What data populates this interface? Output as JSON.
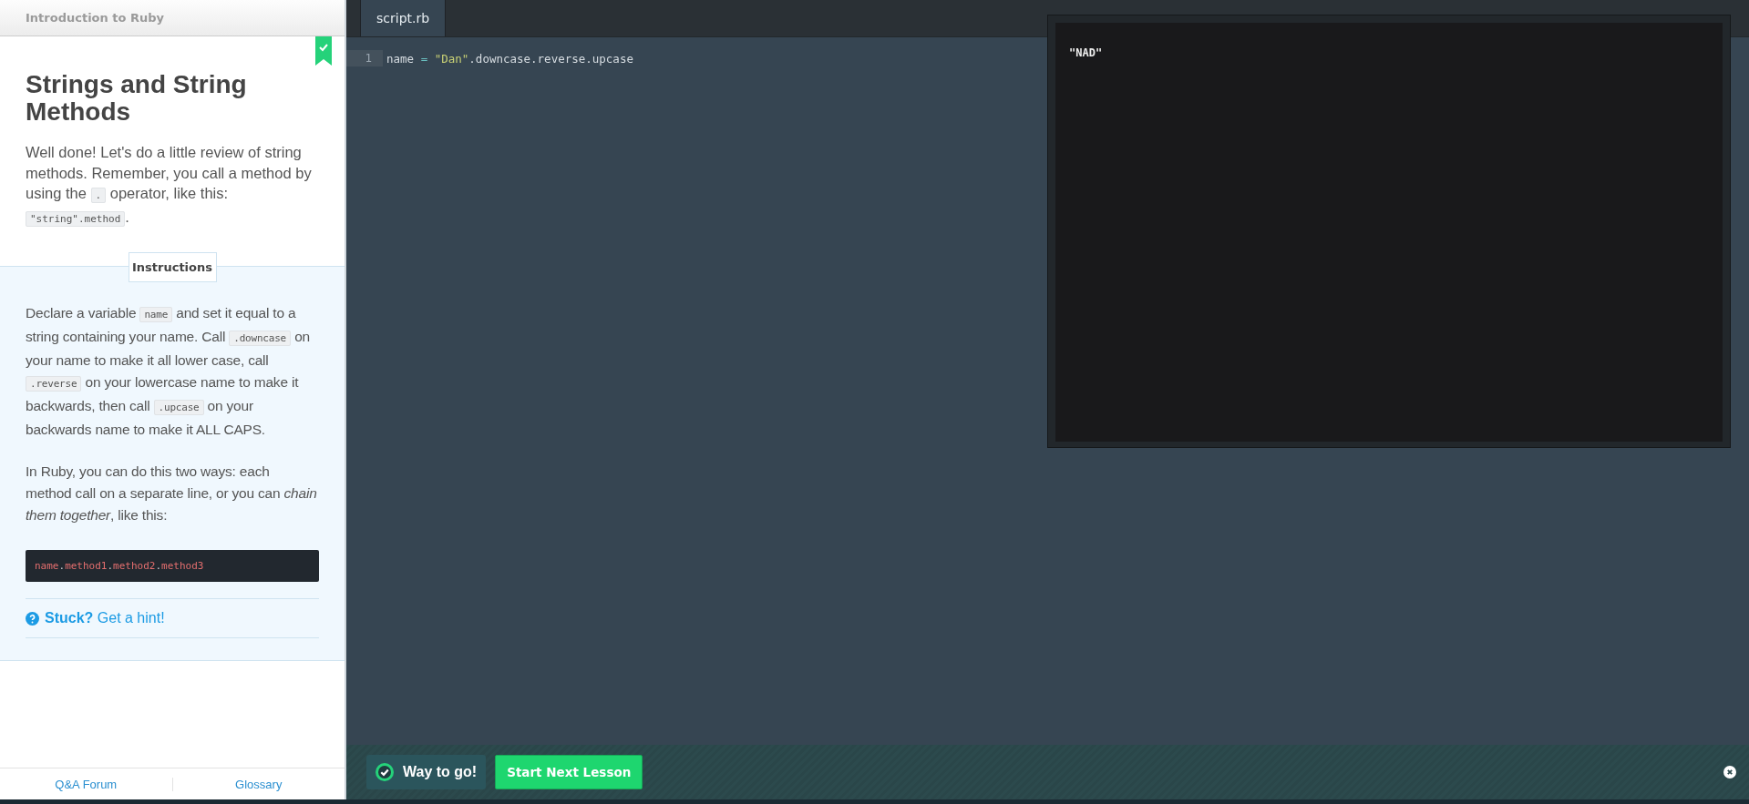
{
  "course": {
    "title": "Introduction to Ruby"
  },
  "lesson": {
    "completed": true,
    "title": "Strings and String Methods",
    "intro": [
      {
        "kind": "text",
        "text": "Well done! Let's do a little review of string methods. Remember, you call a method by using the "
      },
      {
        "kind": "code",
        "text": "."
      },
      {
        "kind": "text",
        "text": " operator, like this: "
      },
      {
        "kind": "code",
        "text": "\"string\".method"
      },
      {
        "kind": "text",
        "text": "."
      }
    ]
  },
  "instructions": {
    "tab": "Instructions",
    "paragraphs": [
      [
        {
          "kind": "text",
          "text": "Declare a variable "
        },
        {
          "kind": "code",
          "text": "name"
        },
        {
          "kind": "text",
          "text": " and set it equal to a string containing your name. Call "
        },
        {
          "kind": "code",
          "text": ".downcase"
        },
        {
          "kind": "text",
          "text": " on your name to make it all lower case, call "
        },
        {
          "kind": "code",
          "text": ".reverse"
        },
        {
          "kind": "text",
          "text": " on your lowercase name to make it backwards, then call "
        },
        {
          "kind": "code",
          "text": ".upcase"
        },
        {
          "kind": "text",
          "text": " on your backwards name to make it ALL CAPS."
        }
      ],
      [
        {
          "kind": "text",
          "text": "In Ruby, you can do this two ways: each method call on a separate line, or you can *chain them together*, like this:"
        }
      ]
    ],
    "code_sample": [
      {
        "kind": "ident",
        "text": "name"
      },
      {
        "kind": "dot",
        "text": "."
      },
      {
        "kind": "ident",
        "text": "method1"
      },
      {
        "kind": "dot",
        "text": "."
      },
      {
        "kind": "ident",
        "text": "method2"
      },
      {
        "kind": "dot",
        "text": "."
      },
      {
        "kind": "ident",
        "text": "method3"
      }
    ],
    "hint": {
      "label": "Stuck?",
      "link": "Get a hint!"
    }
  },
  "footer_links": [
    "Q&A Forum",
    "Glossary"
  ],
  "editor": {
    "tabs": [
      {
        "label": "script.rb",
        "selected": true
      }
    ],
    "lines": [
      {
        "number": "1",
        "tokens": [
          {
            "kind": "plain",
            "text": "name "
          },
          {
            "kind": "op",
            "text": "="
          },
          {
            "kind": "string",
            "text": "\"Dan\""
          },
          {
            "kind": "plain",
            "text": ".downcase.reverse.upcase"
          }
        ]
      }
    ]
  },
  "output": {
    "lines": [
      "\"NAD\""
    ]
  },
  "result_bar": {
    "message": "Way to go!",
    "button": "Start Next Lesson"
  }
}
